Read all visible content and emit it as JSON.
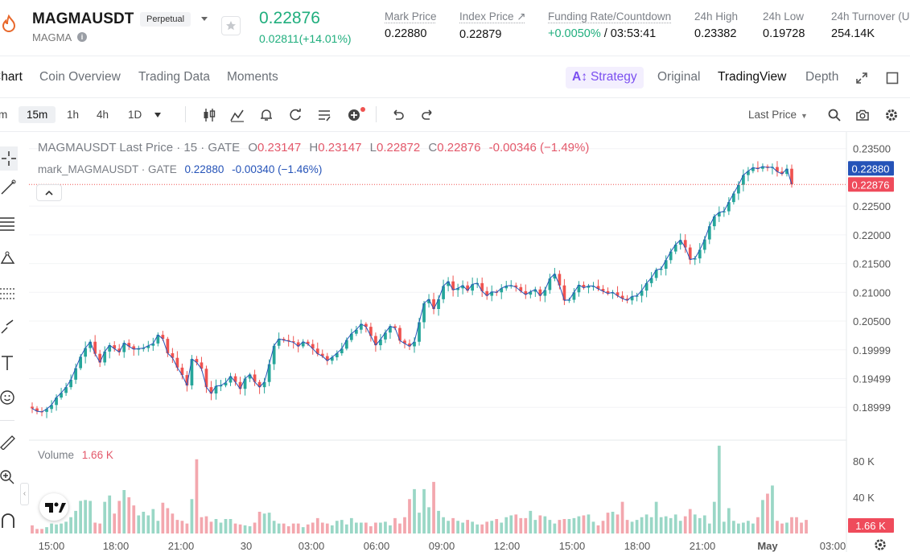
{
  "header": {
    "symbol": "MAGMAUSDT",
    "contract_type": "Perpetual",
    "base_name": "MAGMA",
    "last_price": "0.22876",
    "change": "0.02811(+14.01%)",
    "stats": [
      {
        "label": "Mark Price",
        "value": "0.22880"
      },
      {
        "label": "Index Price ↗",
        "value": "0.22879"
      },
      {
        "label": "Funding Rate/Countdown",
        "value_green": "+0.0050%",
        "value": " / 03:53:41"
      },
      {
        "label": "24h High",
        "value": "0.23382"
      },
      {
        "label": "24h Low",
        "value": "0.19728"
      },
      {
        "label": "24h Turnover (U",
        "value": "254.14K"
      }
    ]
  },
  "tabs": {
    "items": [
      "Chart",
      "Coin Overview",
      "Trading Data",
      "Moments"
    ],
    "strategy_label": "Strategy",
    "views": [
      "Original",
      "TradingView",
      "Depth"
    ]
  },
  "toolbar": {
    "timeframes": [
      "m",
      "15m",
      "1h",
      "4h",
      "1D"
    ],
    "price_source": "Last Price"
  },
  "legend": {
    "main_name": "MAGMAUSDT Last Price · 15 · GATE",
    "open": "O0.23147",
    "high": "H0.23147",
    "low": "L0.22872",
    "close": "C0.22876",
    "change": "-0.00346 (−1.49%)",
    "mark_name": "mark_MAGMAUSDT · GATE",
    "mark_value": "0.22880",
    "mark_change": "-0.00340 (−1.46%)",
    "volume_label": "Volume",
    "volume_value": "1.66 K"
  },
  "price_axis": {
    "ticks": [
      "0.23500",
      "0.22500",
      "0.22000",
      "0.21500",
      "0.21000",
      "0.20500",
      "0.19999",
      "0.19499",
      "0.18999"
    ],
    "mark_badge": "0.22880",
    "last_badge": "0.22876"
  },
  "volume_axis": {
    "ticks": [
      "80 K",
      "40 K"
    ],
    "badge": "1.66 K"
  },
  "time_axis": {
    "ticks": [
      "15:00",
      "18:00",
      "21:00",
      "30",
      "03:00",
      "06:00",
      "09:00",
      "12:00",
      "15:00",
      "18:00",
      "21:00",
      "May",
      "03:00"
    ]
  },
  "colors": {
    "up": "#26a69a",
    "down": "#ef5350",
    "accent_green": "#1fae7d",
    "strategy": "#7b4ff0",
    "mark_line": "#2553b8"
  },
  "chart_data": {
    "type": "candlestick",
    "title": "MAGMAUSDT Last Price · 15 · GATE",
    "y_range": [
      0.1875,
      0.2365
    ],
    "close_series": [
      0.1898,
      0.1893,
      0.1892,
      0.1897,
      0.1904,
      0.1917,
      0.1925,
      0.1935,
      0.1948,
      0.1968,
      0.1988,
      0.2003,
      0.2014,
      0.1993,
      0.1978,
      0.1997,
      0.2008,
      0.2002,
      0.1996,
      0.2012,
      0.2006,
      0.2001,
      0.2002,
      0.2003,
      0.2007,
      0.2011,
      0.2026,
      0.2019,
      0.1994,
      0.1986,
      0.1969,
      0.1956,
      0.1938,
      0.1984,
      0.1978,
      0.1967,
      0.1935,
      0.1924,
      0.1937,
      0.1938,
      0.1943,
      0.1954,
      0.1944,
      0.1932,
      0.195,
      0.1957,
      0.1944,
      0.1935,
      0.1944,
      0.1975,
      0.2007,
      0.2019,
      0.2017,
      0.2015,
      0.2013,
      0.2006,
      0.2014,
      0.201,
      0.2002,
      0.1993,
      0.1989,
      0.1981,
      0.1987,
      0.1994,
      0.2002,
      0.2017,
      0.2028,
      0.2035,
      0.2045,
      0.204,
      0.2024,
      0.2008,
      0.2018,
      0.203,
      0.2041,
      0.2038,
      0.2016,
      0.2011,
      0.2006,
      0.2014,
      0.2048,
      0.2081,
      0.2088,
      0.2071,
      0.2088,
      0.2111,
      0.2119,
      0.2104,
      0.2107,
      0.2112,
      0.2103,
      0.2114,
      0.2116,
      0.2102,
      0.2094,
      0.2101,
      0.21,
      0.2107,
      0.2111,
      0.2112,
      0.2109,
      0.2102,
      0.2096,
      0.2101,
      0.2105,
      0.2094,
      0.2104,
      0.2124,
      0.2132,
      0.2112,
      0.2086,
      0.2087,
      0.21,
      0.2113,
      0.2108,
      0.2111,
      0.2111,
      0.2106,
      0.2102,
      0.2098,
      0.21,
      0.2094,
      0.2089,
      0.2086,
      0.2093,
      0.2094,
      0.2103,
      0.2116,
      0.2125,
      0.2139,
      0.2141,
      0.2156,
      0.2171,
      0.2183,
      0.2191,
      0.2178,
      0.2157,
      0.2159,
      0.2174,
      0.2192,
      0.2215,
      0.2232,
      0.2239,
      0.2241,
      0.2257,
      0.2272,
      0.2287,
      0.2304,
      0.2311,
      0.2317,
      0.2315,
      0.2319,
      0.2317,
      0.2318,
      0.231,
      0.2306,
      0.2315,
      0.2288
    ],
    "volume_k": [
      9,
      5,
      5,
      7,
      11,
      10,
      11,
      13,
      18,
      25,
      36,
      37,
      36,
      12,
      11,
      35,
      42,
      22,
      36,
      48,
      40,
      31,
      20,
      24,
      20,
      27,
      14,
      34,
      28,
      22,
      15,
      14,
      11,
      38,
      82,
      18,
      19,
      13,
      16,
      12,
      16,
      16,
      11,
      10,
      9,
      8,
      12,
      24,
      22,
      23,
      14,
      11,
      11,
      8,
      11,
      11,
      7,
      10,
      12,
      17,
      12,
      11,
      9,
      14,
      15,
      10,
      17,
      12,
      12,
      12,
      8,
      12,
      12,
      13,
      9,
      17,
      11,
      18,
      38,
      49,
      23,
      49,
      29,
      57,
      25,
      18,
      14,
      17,
      14,
      12,
      15,
      13,
      10,
      10,
      13,
      14,
      16,
      12,
      18,
      20,
      21,
      17,
      17,
      25,
      15,
      20,
      19,
      15,
      11,
      15,
      16,
      16,
      17,
      19,
      20,
      21,
      13,
      9,
      14,
      23,
      24,
      21,
      35,
      15,
      13,
      15,
      18,
      21,
      18,
      35,
      18,
      19,
      17,
      21,
      14,
      19,
      27,
      21,
      17,
      20,
      11,
      35,
      97,
      13,
      28,
      14,
      11,
      12,
      14,
      11,
      18,
      37,
      44,
      53,
      14,
      11,
      12,
      18,
      18,
      12,
      15
    ],
    "last_volume": "1.66 K"
  }
}
